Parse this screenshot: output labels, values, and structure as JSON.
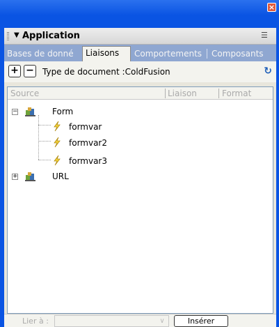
{
  "window": {
    "close_icon": "×"
  },
  "panel": {
    "title": "Application",
    "collapse_glyph": "▼",
    "options_glyph": "☰"
  },
  "tabs": [
    {
      "label": "Bases de donné"
    },
    {
      "label": "Liaisons"
    },
    {
      "label": "Comportements"
    },
    {
      "label": "Composants"
    }
  ],
  "toolbar": {
    "add_label": "+",
    "remove_label": "−",
    "doc_type": "Type de document :ColdFusion",
    "refresh_glyph": "↻"
  },
  "columns": {
    "source": "Source",
    "binding": "Liaison",
    "format": "Format"
  },
  "tree": {
    "form": {
      "label": "Form",
      "expander": "−"
    },
    "formvars": [
      "formvar",
      "formvar2",
      "formvar3"
    ],
    "url": {
      "label": "URL",
      "expander": "+"
    }
  },
  "footer": {
    "bind_label": "Lier à :",
    "select_arrow": "∨",
    "insert_label": "Insérer"
  },
  "colors": {
    "xp_blue": "#0a54e3",
    "tab_bar": "#8fa7d1",
    "panel_bg": "#f3f3ee"
  }
}
